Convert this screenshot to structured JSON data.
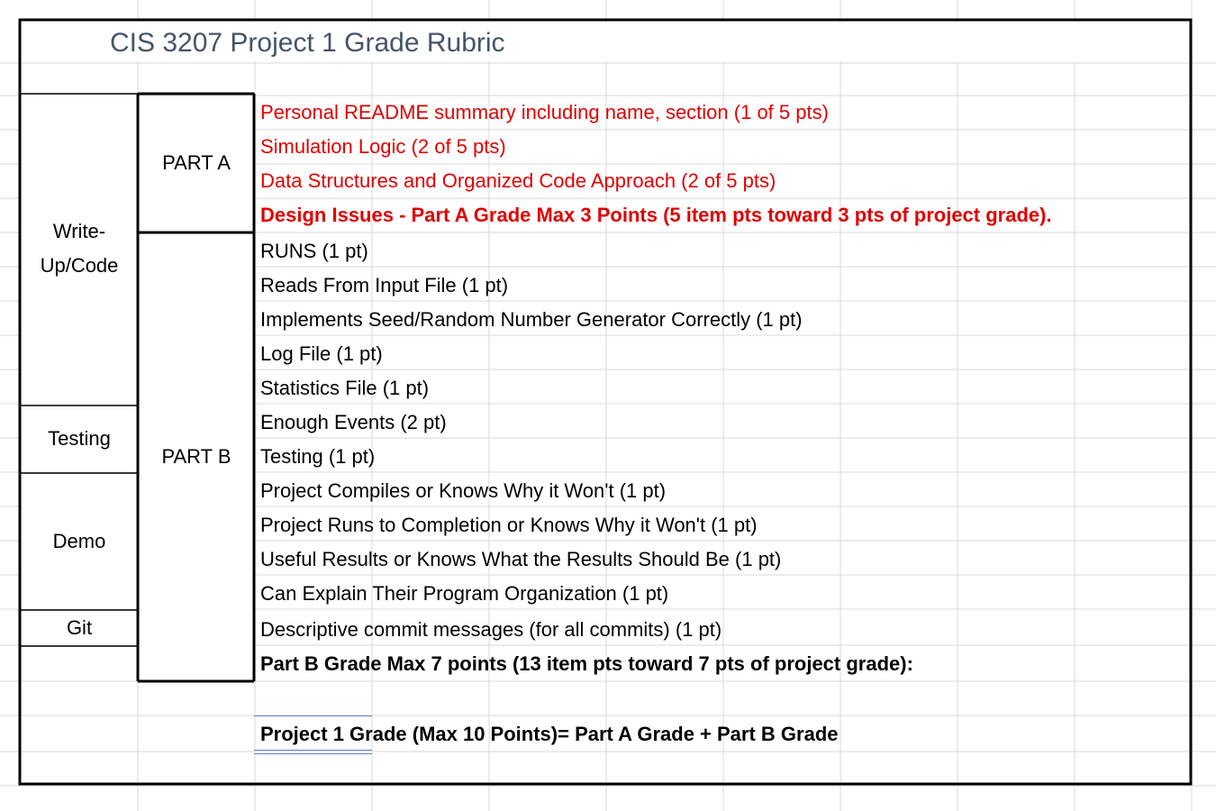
{
  "title": "CIS 3207 Project 1 Grade Rubric",
  "categories": {
    "write_up": [
      "Write-",
      "Up/Code"
    ],
    "testing": "Testing",
    "demo": "Demo",
    "git": "Git"
  },
  "parts": {
    "part_a": "PART A",
    "part_b": "PART B"
  },
  "items": [
    {
      "text": "Personal README summary including name, section (1 of 5 pts)",
      "style": "red"
    },
    {
      "text": "Simulation Logic (2 of 5 pts)",
      "style": "red"
    },
    {
      "text": "Data Structures and Organized Code Approach (2 of 5 pts)",
      "style": "red"
    },
    {
      "text": "Design Issues - Part A Grade Max 3 Points  (5 item pts toward 3 pts of project grade).",
      "style": "red-bold"
    },
    {
      "text": "RUNS (1 pt)",
      "style": "normal"
    },
    {
      "text": "Reads From Input File (1 pt)",
      "style": "normal"
    },
    {
      "text": "Implements Seed/Random Number Generator Correctly (1 pt)",
      "style": "normal"
    },
    {
      "text": "Log File (1 pt)",
      "style": "normal"
    },
    {
      "text": "Statistics File (1 pt)",
      "style": "normal"
    },
    {
      "text": "Enough Events (2 pt)",
      "style": "normal"
    },
    {
      "text": "Testing (1 pt)",
      "style": "normal"
    },
    {
      "text": "Project Compiles or Knows Why it Won't (1 pt)",
      "style": "normal"
    },
    {
      "text": "Project Runs to Completion or Knows Why it Won't (1 pt)",
      "style": "normal"
    },
    {
      "text": "Useful Results or Knows What the Results Should Be (1 pt)",
      "style": "normal"
    },
    {
      "text": "Can Explain Their Program Organization (1 pt)",
      "style": "normal"
    },
    {
      "text": "Descriptive commit messages (for all commits) (1 pt)",
      "style": "normal"
    },
    {
      "text": "Part B Grade  Max 7 points (13 item pts toward 7 pts of project grade):",
      "style": "bold"
    }
  ],
  "final": "Project 1 Grade (Max 10 Points)= Part A Grade + Part B Grade",
  "colors": {
    "red": "#e00000",
    "title": "#44546a",
    "gridline": "#d9d9d9",
    "border": "#000000"
  }
}
